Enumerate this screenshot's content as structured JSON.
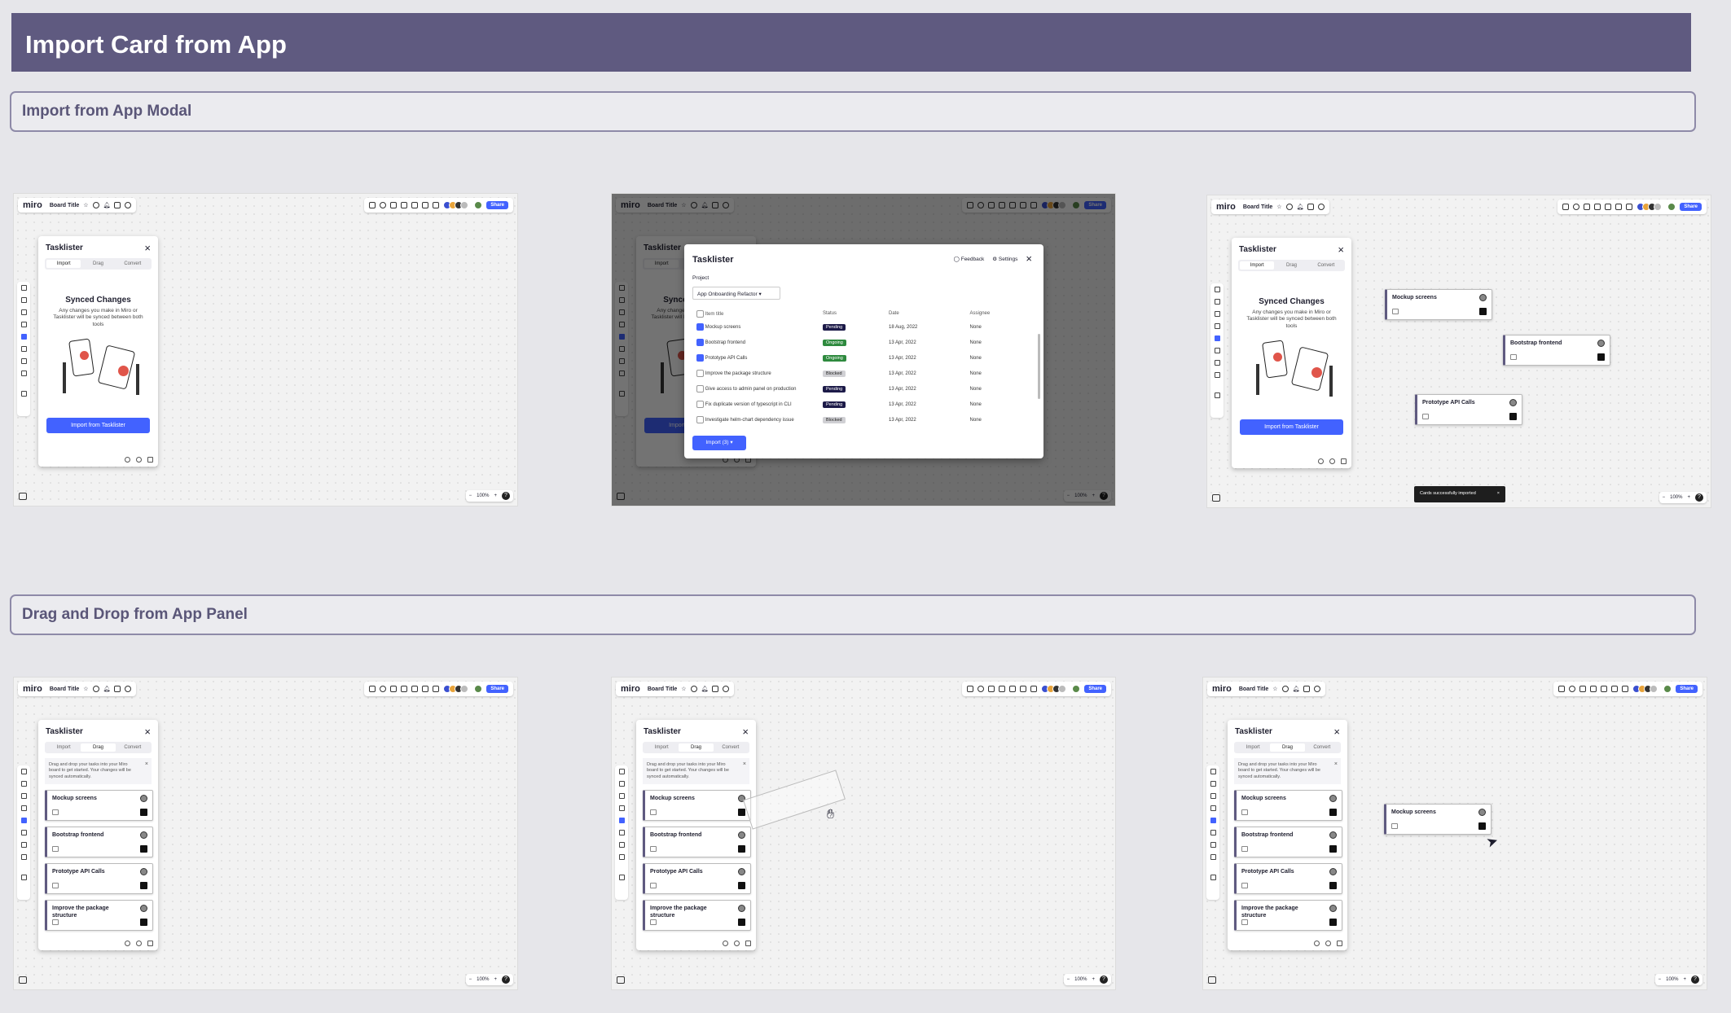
{
  "page_title": "Import Card from App",
  "sections": {
    "import_modal": "Import from App Modal",
    "drag_drop": "Drag and Drop from App Panel"
  },
  "board": {
    "logo": "miro",
    "title": "Board Title",
    "share_label": "Share",
    "zoom": "100%",
    "help": "?"
  },
  "panel": {
    "title": "Tasklister",
    "tabs": [
      "Import",
      "Drag",
      "Convert"
    ],
    "sync_title": "Synced Changes",
    "sync_desc": "Any changes you make in Miro or Tasklister will be synced between both tools",
    "import_button": "Import from Tasklister",
    "drag_note": "Drag and drop your tasks into your Miro board to get started. Your changes will be synced automatically."
  },
  "cards": [
    "Mockup screens",
    "Bootstrap frontend",
    "Prototype API Calls",
    "Improve the package structure"
  ],
  "modal": {
    "title": "Tasklister",
    "feedback": "Feedback",
    "settings": "Settings",
    "project_label": "Project",
    "project_value": "App Onboarding Refactor",
    "columns": [
      "Item title",
      "Status",
      "Date",
      "Assignee"
    ],
    "rows": [
      {
        "title": "Mockup screens",
        "status": "Pending",
        "date": "18 Aug, 2022",
        "assignee": "None",
        "checked": true
      },
      {
        "title": "Bootstrap frontend",
        "status": "Ongoing",
        "date": "13 Apr, 2022",
        "assignee": "None",
        "checked": true
      },
      {
        "title": "Prototype API Calls",
        "status": "Ongoing",
        "date": "13 Apr, 2022",
        "assignee": "None",
        "checked": true
      },
      {
        "title": "Improve the package structure",
        "status": "Blocked",
        "date": "13 Apr, 2022",
        "assignee": "None",
        "checked": false
      },
      {
        "title": "Give access to admin panel on production",
        "status": "Pending",
        "date": "13 Apr, 2022",
        "assignee": "None",
        "checked": false
      },
      {
        "title": "Fix duplicate version of typescript in CLI",
        "status": "Pending",
        "date": "13 Apr, 2022",
        "assignee": "None",
        "checked": false
      },
      {
        "title": "Investigate helm-chart dependency issue",
        "status": "Blocked",
        "date": "13 Apr, 2022",
        "assignee": "None",
        "checked": false
      }
    ],
    "import_button": "Import (3)"
  },
  "toast": "Cards successfully imported",
  "colors": {
    "header": "#5f5a80",
    "accent": "#4262ff",
    "pending": "#1c1a48",
    "ongoing": "#2e8a3e",
    "blocked": "#d0d0d4"
  }
}
